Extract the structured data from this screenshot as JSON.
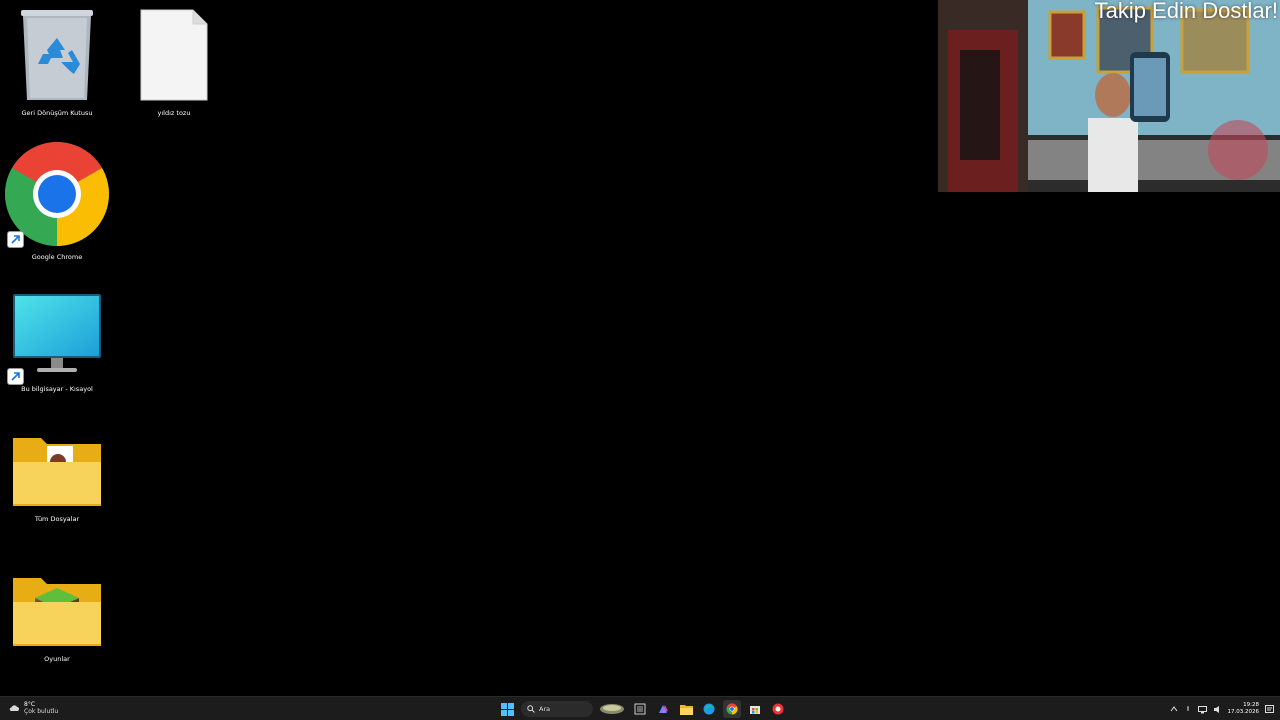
{
  "desktop": {
    "icons": [
      {
        "id": "recycle-bin",
        "label": "Geri Dönüşüm Kutusu"
      },
      {
        "id": "text-file",
        "label": "yıldız tozu"
      },
      {
        "id": "chrome",
        "label": "Google Chrome"
      },
      {
        "id": "this-pc",
        "label": "Bu bilgisayar - Kısayol"
      },
      {
        "id": "all-files",
        "label": "Tüm Dosyalar"
      },
      {
        "id": "games",
        "label": "Oyunlar"
      }
    ]
  },
  "webcam": {
    "overlay_text": "Takip Edin Dostlar!"
  },
  "taskbar": {
    "weather": {
      "temp": "8°C",
      "condition": "Çok bulutlu"
    },
    "search": {
      "placeholder": "Ara"
    },
    "pinned": [
      "start-icon",
      "search-icon",
      "widget-icon",
      "task-view-icon",
      "copilot-icon",
      "file-explorer-icon",
      "edge-icon",
      "chrome-icon",
      "store-icon",
      "app-icon"
    ],
    "clock": {
      "time": "19:28",
      "date": "17.03.2026"
    }
  },
  "colors": {
    "taskbar_bg": "#1c1c1c",
    "desktop_bg": "#000000",
    "folder": "#f5c518",
    "accent": "#0078d4"
  }
}
